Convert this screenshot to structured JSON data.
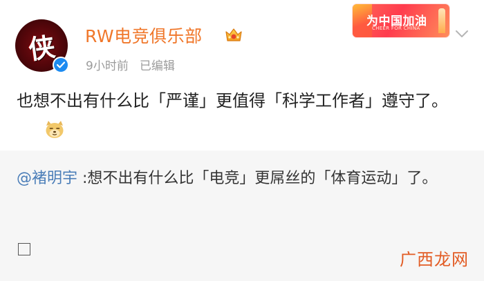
{
  "post": {
    "author": {
      "avatar_glyph": "侠",
      "name": "RW电竞俱乐部",
      "vip_icon": "crown-vip-icon",
      "verified_icon": "verified-check-icon"
    },
    "meta": {
      "time": "9小时前",
      "edited": "已编辑"
    },
    "banner": {
      "text": "为中国加油",
      "sub": "CHEER FOR CHINA"
    },
    "more_icon": "chevron-down-icon",
    "text": "也想不出有什么比「严谨」更值得「科学工作者」遵守了。",
    "emoji": "doge-emoji"
  },
  "repost": {
    "mention": "@褚明宇",
    "text": " :想不出有什么比「电竞」更屌丝的「体育运动」了。",
    "placeholder_box": "☐"
  },
  "watermark": "广西龙网",
  "colors": {
    "username": "#f0772a",
    "mention": "#4a7db8",
    "meta": "#9b9b9b",
    "repost_bg": "#f6f6f6",
    "watermark": "#e25b23"
  }
}
